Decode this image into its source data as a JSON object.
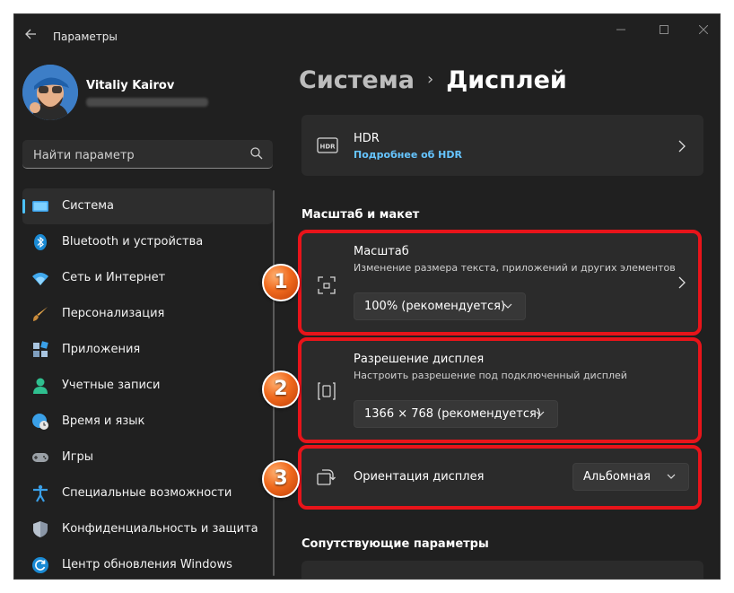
{
  "window": {
    "title": "Параметры",
    "back_icon": "arrow-left-icon"
  },
  "user": {
    "name": "Vitaliy Kairov",
    "email_redacted": true
  },
  "search": {
    "placeholder": "Найти параметр"
  },
  "sidebar": {
    "items": [
      {
        "label": "Система",
        "icon": "system-display-icon",
        "active": true
      },
      {
        "label": "Bluetooth и устройства",
        "icon": "bluetooth-icon"
      },
      {
        "label": "Сеть и Интернет",
        "icon": "wifi-icon"
      },
      {
        "label": "Персонализация",
        "icon": "paintbrush-icon"
      },
      {
        "label": "Приложения",
        "icon": "apps-icon"
      },
      {
        "label": "Учетные записи",
        "icon": "person-icon"
      },
      {
        "label": "Время и язык",
        "icon": "globe-clock-icon"
      },
      {
        "label": "Игры",
        "icon": "gamepad-icon"
      },
      {
        "label": "Специальные возможности",
        "icon": "accessibility-icon"
      },
      {
        "label": "Конфиденциальность и защита",
        "icon": "shield-icon"
      },
      {
        "label": "Центр обновления Windows",
        "icon": "windows-update-icon"
      }
    ]
  },
  "breadcrumb": {
    "parent": "Система",
    "separator": "›",
    "current": "Дисплей"
  },
  "hdr": {
    "title": "HDR",
    "link": "Подробнее об HDR",
    "icon": "hdr-icon"
  },
  "scale_layout": {
    "section_label": "Масштаб и макет",
    "scale": {
      "title": "Масштаб",
      "subtitle": "Изменение размера текста, приложений и других элементов",
      "value": "100% (рекомендуется)",
      "icon": "scale-icon"
    },
    "resolution": {
      "title": "Разрешение дисплея",
      "subtitle": "Настроить разрешение под подключенный дисплей",
      "value": "1366 × 768 (рекомендуется)",
      "icon": "resolution-icon"
    },
    "orientation": {
      "title": "Ориентация дисплея",
      "value": "Альбомная",
      "icon": "orientation-icon"
    }
  },
  "related": {
    "section_label": "Сопутствующие параметры"
  },
  "badges": [
    "1",
    "2",
    "3"
  ],
  "colors": {
    "accent": "#4cc2ff",
    "highlight": "#e8141a",
    "badge": "#f06a1e",
    "link": "#66c5ff"
  }
}
